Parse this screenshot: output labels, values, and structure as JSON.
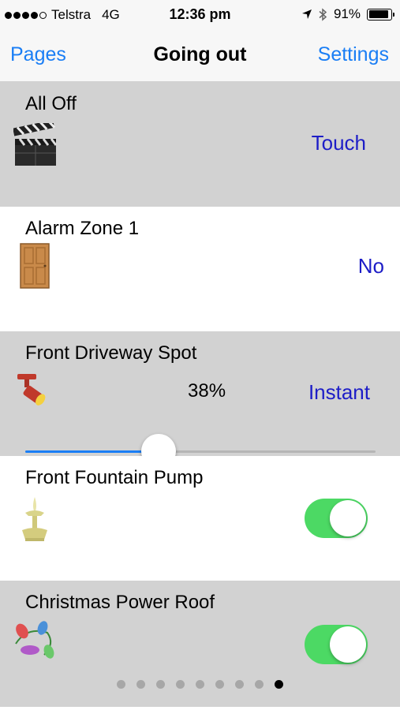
{
  "status_bar": {
    "carrier": "Telstra",
    "network": "4G",
    "time": "12:36 pm",
    "battery_text": "91%",
    "battery_level": 0.91,
    "signal_bars_filled": 4,
    "signal_bars_total": 5,
    "location_icon": "location-arrow-icon",
    "bluetooth_icon": "bluetooth-icon"
  },
  "nav": {
    "back_label": "Pages",
    "title": "Going out",
    "settings_label": "Settings",
    "accent_color": "#1a7ef5"
  },
  "devices": [
    {
      "label": "All Off",
      "icon": "clapperboard-icon",
      "action": "Touch"
    },
    {
      "label": "Alarm Zone 1",
      "icon": "door-icon",
      "action": "No"
    },
    {
      "label": "Front Driveway Spot",
      "icon": "spotlight-icon",
      "percent_text": "38%",
      "action": "Instant",
      "slider_value": 0.38
    },
    {
      "label": "Front Fountain Pump",
      "icon": "fountain-icon",
      "toggle_on": true
    },
    {
      "label": "Christmas Power Roof",
      "icon": "christmas-lights-icon",
      "toggle_on": true
    }
  ],
  "page_indicator": {
    "total": 9,
    "current": 9
  },
  "colors": {
    "row_gray": "#d2d2d2",
    "action_blue": "#1d1dc7",
    "toggle_green": "#4cd964"
  }
}
